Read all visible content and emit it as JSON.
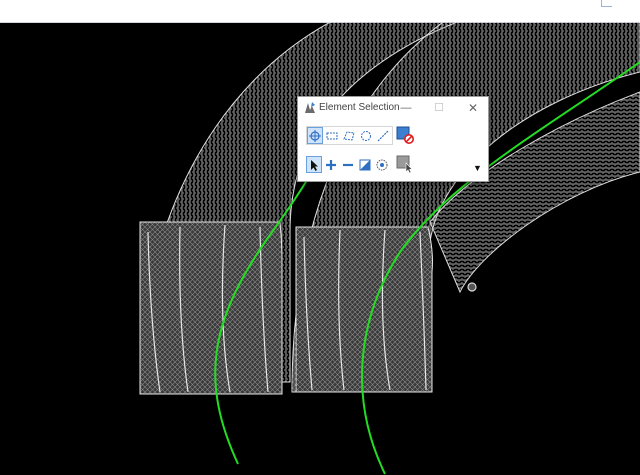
{
  "dialog": {
    "title": "Element Selection",
    "minimize_glyph": "—",
    "maximize_glyph": "☐",
    "close_glyph": "✕",
    "more_glyph": "▼"
  },
  "tools": {
    "row1": [
      {
        "name": "individual-method-icon",
        "active": true
      },
      {
        "name": "block-method-icon",
        "active": false
      },
      {
        "name": "shape-method-icon",
        "active": false
      },
      {
        "name": "circle-method-icon",
        "active": false
      },
      {
        "name": "line-method-icon",
        "active": false
      }
    ],
    "row2": [
      {
        "name": "new-mode-icon",
        "active": true
      },
      {
        "name": "add-mode-icon",
        "active": false
      },
      {
        "name": "subtract-mode-icon",
        "active": false
      },
      {
        "name": "invert-mode-icon",
        "active": false
      },
      {
        "name": "select-all-icon",
        "active": false
      }
    ],
    "right": [
      "clear-selection-icon",
      "selection-settings-icon"
    ]
  },
  "colors": {
    "background": "#000000",
    "wireframe": "#d0d0d0",
    "alignment": "#22dd22",
    "accent_blue": "#3c7fd0",
    "forbidden_red": "#e21b1b"
  }
}
